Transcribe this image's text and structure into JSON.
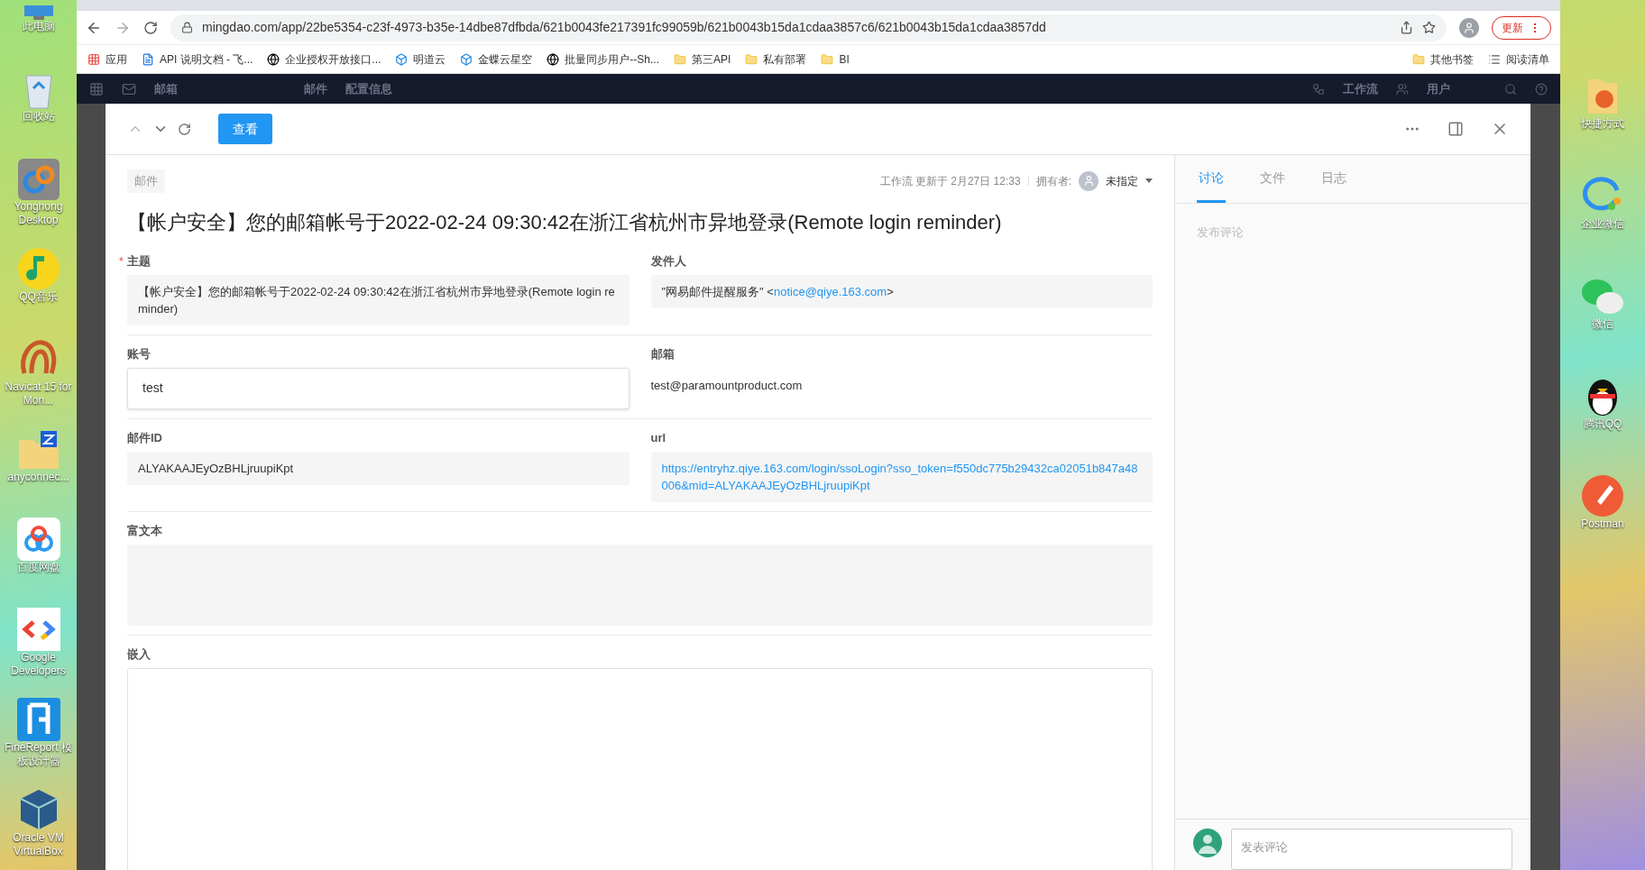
{
  "desktop_left": [
    {
      "label": "此电脑"
    },
    {
      "label": "回收站"
    },
    {
      "label": "Yonghong Desktop"
    },
    {
      "label": "QQ音乐"
    },
    {
      "label": "Navicat 15 for Mon..."
    },
    {
      "label": "anyconnec..."
    },
    {
      "label": "百度网盘"
    },
    {
      "label": "Google Developers"
    },
    {
      "label": "FineReport 模板设计器"
    },
    {
      "label": "Oracle VM VirtualBox"
    }
  ],
  "desktop_right": [
    {
      "label": "快捷方式"
    },
    {
      "label": "企业微信"
    },
    {
      "label": "微信"
    },
    {
      "label": "腾讯QQ"
    },
    {
      "label": "Postman"
    }
  ],
  "browser": {
    "url": "mingdao.com/app/22be5354-c23f-4973-b35e-14dbe87dfbda/621b0043fe217391fc99059b/621b0043b15da1cdaa3857c6/621b0043b15da1cdaa3857dd",
    "update_button": "更新",
    "bookmarks": [
      {
        "label": "应用",
        "kind": "apps"
      },
      {
        "label": "API 说明文档 - 飞...",
        "kind": "doc"
      },
      {
        "label": "企业授权开放接口...",
        "kind": "site"
      },
      {
        "label": "明道云",
        "kind": "cube"
      },
      {
        "label": "金蝶云星空",
        "kind": "cube"
      },
      {
        "label": "批量同步用户--Sh...",
        "kind": "site"
      },
      {
        "label": "第三API",
        "kind": "folder"
      },
      {
        "label": "私有部署",
        "kind": "folder"
      },
      {
        "label": "BI",
        "kind": "folder"
      }
    ],
    "bookmarks_right": [
      {
        "label": "其他书签",
        "kind": "folder"
      },
      {
        "label": "阅读清单",
        "kind": "list"
      }
    ]
  },
  "app_header": {
    "left": [
      "邮箱",
      "邮件",
      "配置信息"
    ],
    "right": [
      "工作流",
      "用户"
    ]
  },
  "record": {
    "view_button": "查看",
    "tag": "邮件",
    "updated": "工作流 更新于 2月27日 12:33",
    "owner_label": "拥有者:",
    "owner": "未指定",
    "title": "【帐户安全】您的邮箱帐号于2022-02-24 09:30:42在浙江省杭州市异地登录(Remote login reminder)",
    "required_mark": "*",
    "rows": [
      [
        {
          "label": "主题",
          "required": true,
          "kind": "box",
          "parts": [
            {
              "text": "【帐户安全】您的邮箱帐号于2022-02-24 09:30:42在浙江省杭州市异地登录(Remote login reminder)",
              "link": false
            }
          ]
        },
        {
          "label": "发件人",
          "required": false,
          "kind": "box",
          "parts": [
            {
              "text": "\"网易邮件提醒服务\" <",
              "link": false
            },
            {
              "text": "notice@qiye.163.com",
              "link": true
            },
            {
              "text": ">",
              "link": false
            }
          ]
        }
      ],
      [
        {
          "label": "账号",
          "required": false,
          "kind": "input",
          "parts": [
            {
              "text": "test",
              "link": false
            }
          ]
        },
        {
          "label": "邮箱",
          "required": false,
          "kind": "plain",
          "parts": [
            {
              "text": "test@paramountproduct.com",
              "link": false
            }
          ]
        }
      ],
      [
        {
          "label": "邮件ID",
          "required": false,
          "kind": "box",
          "parts": [
            {
              "text": "ALYAKAAJEyOzBHLjruupiKpt",
              "link": false
            }
          ]
        },
        {
          "label": "url",
          "required": false,
          "kind": "box",
          "parts": [
            {
              "text": "https://entryhz.qiye.163.com/login/ssoLogin?sso_token=f550dc775b29432ca02051b847a48006&mid=ALYAKAAJEyOzBHLjruupiKpt",
              "link": true
            }
          ]
        }
      ],
      [
        {
          "label": "富文本",
          "required": false,
          "kind": "rich"
        }
      ],
      [
        {
          "label": "嵌入",
          "required": false,
          "kind": "embed"
        }
      ]
    ]
  },
  "side_panel": {
    "tabs": [
      {
        "label": "讨论",
        "selected": true
      },
      {
        "label": "文件",
        "selected": false
      },
      {
        "label": "日志",
        "selected": false
      }
    ],
    "empty_text": "发布评论",
    "comment_placeholder": "发表评论"
  }
}
